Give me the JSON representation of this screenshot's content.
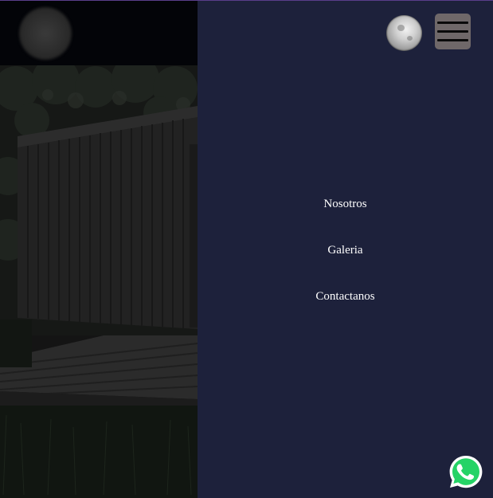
{
  "nav": {
    "items": [
      {
        "label": "Nosotros"
      },
      {
        "label": "Galeria"
      },
      {
        "label": "Contactanos"
      }
    ]
  },
  "icons": {
    "theme_toggle": "moon-icon",
    "menu": "hamburger-menu-icon",
    "whatsapp": "whatsapp-icon",
    "logo": "logo"
  },
  "colors": {
    "panel_background": "#1d213b",
    "menu_button": "#6f6869",
    "nav_text": "#ffffff",
    "whatsapp_green": "#25d366"
  }
}
